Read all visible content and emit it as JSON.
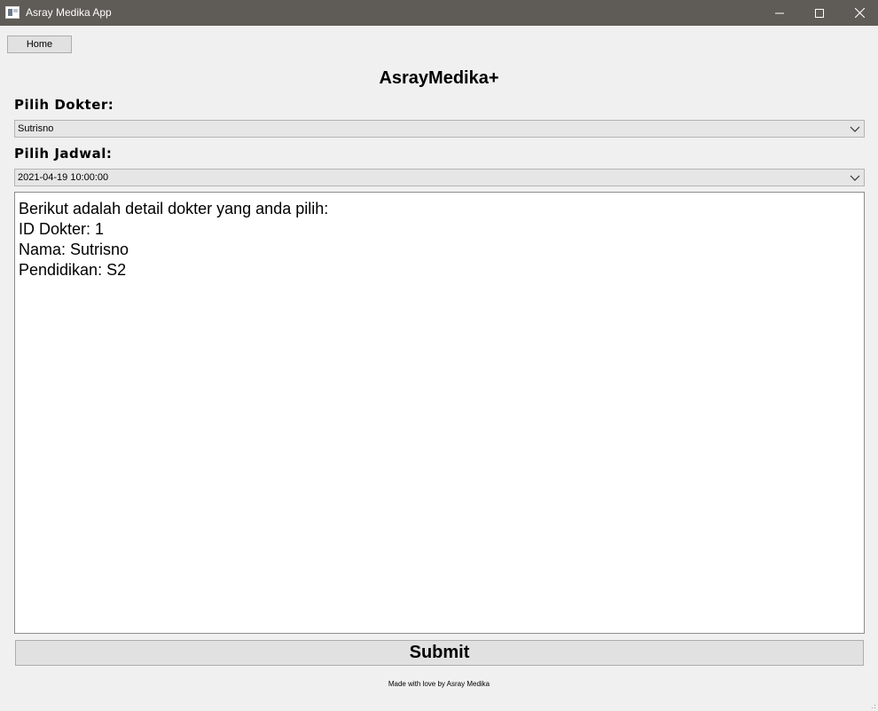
{
  "window": {
    "title": "Asray Medika App",
    "app_icon": "app-window-icon",
    "controls": {
      "minimize_icon": "minimize-icon",
      "maximize_icon": "maximize-icon",
      "close_icon": "close-icon"
    }
  },
  "nav": {
    "home_label": "Home"
  },
  "header": {
    "title": "AsrayMedika+"
  },
  "form": {
    "doctor_label": "Pilih Dokter:",
    "doctor_selected": "Sutrisno",
    "schedule_label": "Pilih Jadwal:",
    "schedule_selected": "2021-04-19 10:00:00",
    "dropdown_icon": "chevron-down-icon"
  },
  "details": {
    "lines": [
      "Berikut adalah detail dokter yang anda pilih:",
      "ID Dokter: 1",
      "Nama: Sutrisno",
      "Pendidikan: S2"
    ]
  },
  "actions": {
    "submit_label": "Submit"
  },
  "footer": {
    "text": "Made with love by Asray Medika"
  },
  "colors": {
    "titlebar": "#5f5b56",
    "background": "#f0f0f0",
    "button": "#e1e1e1",
    "text": "#000000"
  }
}
